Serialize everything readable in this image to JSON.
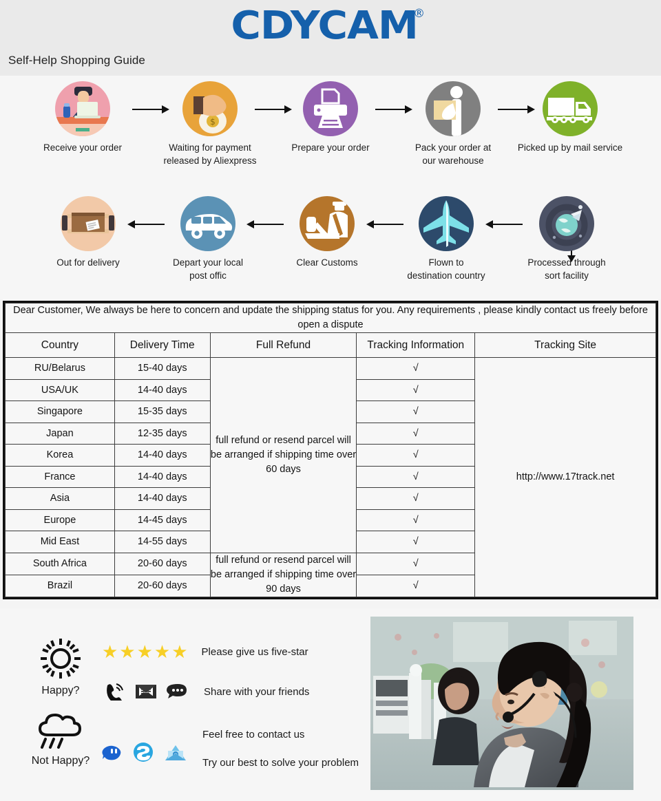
{
  "header": {
    "logo": "CDYCAM",
    "logo_trademark": "®",
    "logo_color": "#1560ab",
    "guide_title": "Self-Help Shopping Guide",
    "background": "#eaeaea"
  },
  "flow": {
    "steps_row1": [
      {
        "label": "Receive your order",
        "icon": "person-at-laptop-icon",
        "color": "#efa0ad"
      },
      {
        "label": "Waiting for payment\nreleased by Aliexpress",
        "icon": "hand-money-bag-icon",
        "color": "#e8a33a"
      },
      {
        "label": "Prepare your order",
        "icon": "printer-icon",
        "color": "#9360b0"
      },
      {
        "label": "Pack your order at\nour warehouse",
        "icon": "worker-carrying-box-icon",
        "color": "#808080"
      },
      {
        "label": "Picked up by mail service",
        "icon": "delivery-truck-icon",
        "color": "#7fb12a"
      }
    ],
    "steps_row2": [
      {
        "label": "Out for delivery",
        "icon": "mailbox-parcel-icon",
        "color": "#f2c9a8"
      },
      {
        "label": "Depart your local\npost offic",
        "icon": "delivery-van-icon",
        "color": "#5b92b5"
      },
      {
        "label": "Clear  Customs",
        "icon": "customs-officer-icon",
        "color": "#b5752b"
      },
      {
        "label": "Flown to\ndestination country",
        "icon": "airplane-icon",
        "color": "#2d4a6b"
      },
      {
        "label": "Processed through\nsort facility",
        "icon": "sort-facility-globe-icon",
        "color": "#4c5266"
      }
    ],
    "arrow_right": "arrow-right-icon",
    "arrow_left": "arrow-left-icon",
    "arrow_down": "arrow-down-icon"
  },
  "table": {
    "notice": "Dear Customer, We always be here to concern and update the shipping status for you.  Any requirements , please kindly contact us freely before open a dispute",
    "headers": [
      "Country",
      "Delivery Time",
      "Full Refund",
      "Tracking Information",
      "Tracking Site"
    ],
    "rows": [
      {
        "country": "RU/Belarus",
        "time": "15-40 days",
        "tracking": "√"
      },
      {
        "country": "USA/UK",
        "time": "14-40 days",
        "tracking": "√"
      },
      {
        "country": "Singapore",
        "time": "15-35 days",
        "tracking": "√"
      },
      {
        "country": "Japan",
        "time": "12-35 days",
        "tracking": "√"
      },
      {
        "country": "Korea",
        "time": "14-40 days",
        "tracking": "√"
      },
      {
        "country": "France",
        "time": "14-40 days",
        "tracking": "√"
      },
      {
        "country": "Asia",
        "time": "14-40 days",
        "tracking": "√"
      },
      {
        "country": "Europe",
        "time": "14-45 days",
        "tracking": "√"
      },
      {
        "country": "Mid East",
        "time": "14-55 days",
        "tracking": "√"
      },
      {
        "country": "South Africa",
        "time": "20-60 days",
        "tracking": "√"
      },
      {
        "country": "Brazil",
        "time": "20-60 days",
        "tracking": "√"
      }
    ],
    "refund_group_1": "full refund or resend parcel will be arranged if shipping time over 60 days",
    "refund_group_2": "full refund or resend parcel will be arranged if shipping time over 90 days",
    "tracking_site": "http://www.17track.net"
  },
  "footer": {
    "happy_label": "Happy?",
    "happy_icon": "sun-icon",
    "not_happy_label": "Not Happy?",
    "not_happy_icon": "rain-cloud-icon",
    "stars": "★★★★★",
    "star_count": 5,
    "star_color": "#f7cf26",
    "five_star_text": "Please give us five-star",
    "share_text": "Share with your friends",
    "share_icons": [
      "phone-ring-icon",
      "envelope-icon",
      "chat-bubble-icon"
    ],
    "contact_text": "Feel free to contact us",
    "solve_text": "Try our best to solve your problem",
    "contact_icons": [
      "aliexpress-message-icon",
      "skype-icon",
      "email-icon"
    ],
    "photo_alt": "call-center-agent-photo"
  }
}
